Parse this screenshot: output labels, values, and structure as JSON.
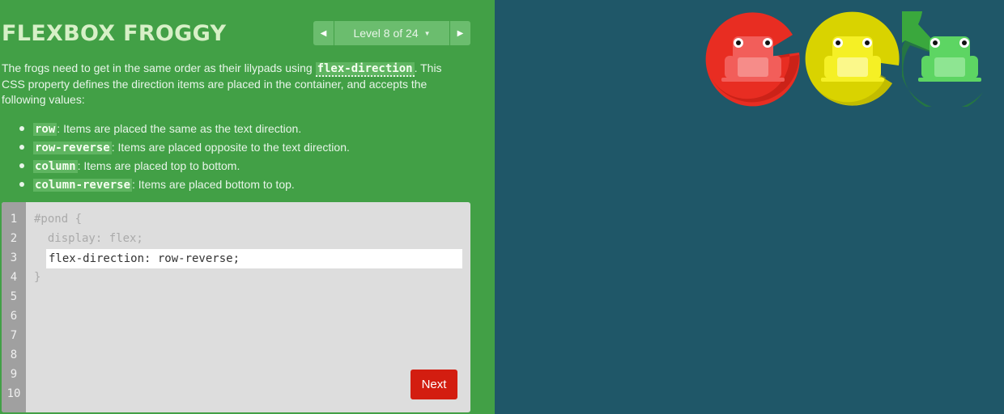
{
  "app": {
    "title": "FLEXBOX FROGGY"
  },
  "level_nav": {
    "prev_icon": "triangle-left-icon",
    "label": "Level 8 of 24",
    "caret_icon": "caret-down-icon",
    "next_icon": "triangle-right-icon"
  },
  "instructions": {
    "intro_before": "The frogs need to get in the same order as their lilypads using ",
    "intro_code": "flex-direction",
    "intro_after": ". This CSS property defines the direction items are placed in the container, and accepts the following values:",
    "values": [
      {
        "code": "row",
        "text": ": Items are placed the same as the text direction."
      },
      {
        "code": "row-reverse",
        "text": ": Items are placed opposite to the text direction."
      },
      {
        "code": "column",
        "text": ": Items are placed top to bottom."
      },
      {
        "code": "column-reverse",
        "text": ": Items are placed bottom to top."
      }
    ]
  },
  "editor": {
    "line_numbers": [
      "1",
      "2",
      "3",
      "4",
      "5",
      "6",
      "7",
      "8",
      "9",
      "10"
    ],
    "line1": "#pond {",
    "line2": "  display: flex;",
    "input_value": "flex-direction: row-reverse;",
    "line4": "}",
    "next_label": "Next"
  },
  "pond": {
    "lilypads": [
      {
        "color": "red",
        "hex": "#d11e15"
      },
      {
        "color": "yellow",
        "hex": "#c9c400"
      },
      {
        "color": "green",
        "hex": "#2e9a30"
      }
    ],
    "frogs": [
      {
        "color": "red",
        "hex": "#f25e5a"
      },
      {
        "color": "yellow",
        "hex": "#f5f025"
      },
      {
        "color": "green",
        "hex": "#5dd563"
      }
    ]
  },
  "colors": {
    "sidebar_bg": "#42a046",
    "pond_bg": "#1f5768",
    "next_button": "#d31d10"
  }
}
